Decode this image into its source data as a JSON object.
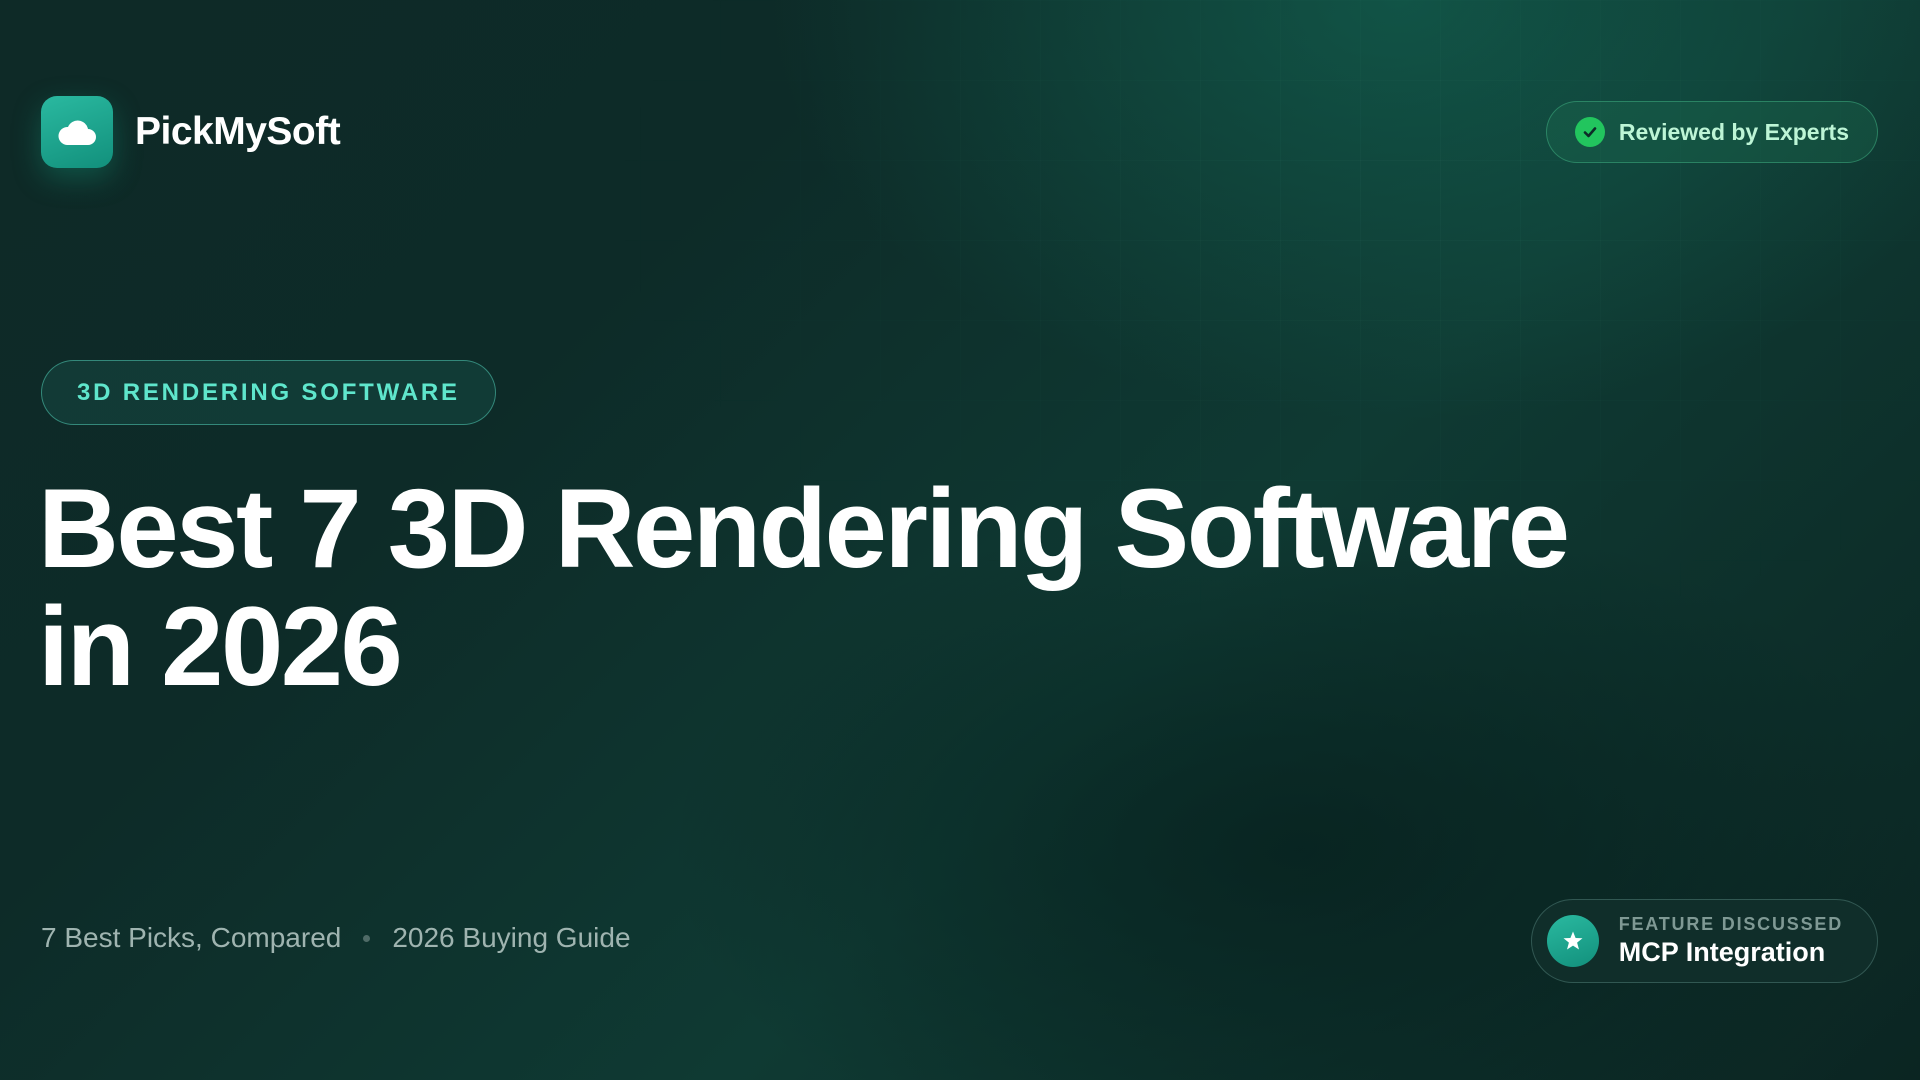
{
  "brand": {
    "name": "PickMySoft",
    "logo_icon": "cloud-icon"
  },
  "badge": {
    "label": "Reviewed by Experts",
    "icon": "check-circle-icon",
    "color": "#22c55e"
  },
  "category": {
    "label": "3D RENDERING SOFTWARE"
  },
  "title": {
    "line1": "Best 7 3D Rendering Software",
    "line2": "in 2026"
  },
  "meta": {
    "item1": "7 Best Picks, Compared",
    "item2": "2026 Buying Guide"
  },
  "feature": {
    "kicker": "FEATURE DISCUSSED",
    "value": "MCP Integration",
    "icon": "star-icon"
  },
  "colors": {
    "accent": "#2ab9a0",
    "category_text": "#5fe6cc",
    "background": "#0d2b28"
  }
}
